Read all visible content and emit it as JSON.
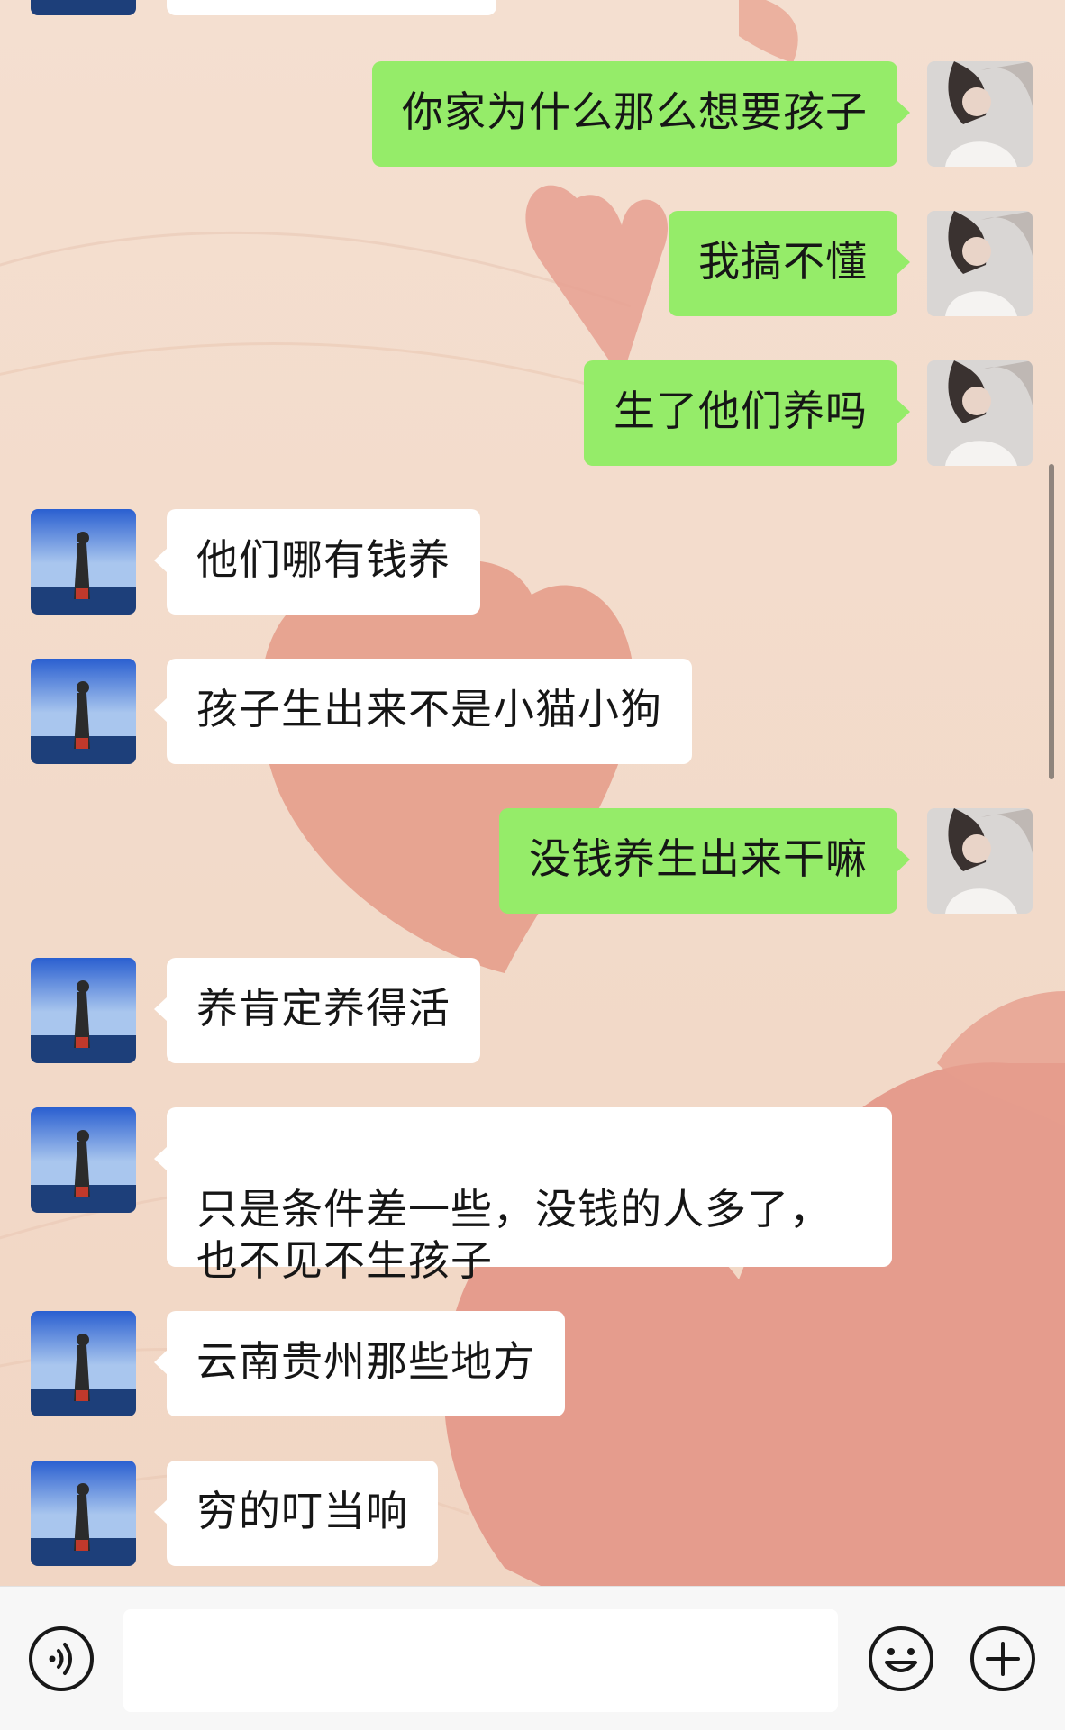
{
  "colors": {
    "background": "#f3dccb",
    "heart": "#e8a090",
    "outgoing_bubble": "#95ec69",
    "incoming_bubble": "#ffffff"
  },
  "avatars": {
    "self": "avatar-woman-photo",
    "contact": "avatar-man-by-sea-photo"
  },
  "messages": [
    {
      "side": "in",
      "text": ""
    },
    {
      "side": "out",
      "text": "你家为什么那么想要孩子"
    },
    {
      "side": "out",
      "text": "我搞不懂"
    },
    {
      "side": "out",
      "text": "生了他们养吗"
    },
    {
      "side": "in",
      "text": "他们哪有钱养"
    },
    {
      "side": "in",
      "text": "孩子生出来不是小猫小狗"
    },
    {
      "side": "out",
      "text": "没钱养生出来干嘛"
    },
    {
      "side": "in",
      "text": "养肯定养得活"
    },
    {
      "side": "in",
      "text": "只是条件差一些，没钱的人多了，\n也不见不生孩子"
    },
    {
      "side": "in",
      "text": "云南贵州那些地方"
    },
    {
      "side": "in",
      "text": "穷的叮当响"
    }
  ],
  "input_bar": {
    "input_value": "",
    "icons": [
      "voice-icon",
      "emoji-icon",
      "plus-icon"
    ]
  }
}
